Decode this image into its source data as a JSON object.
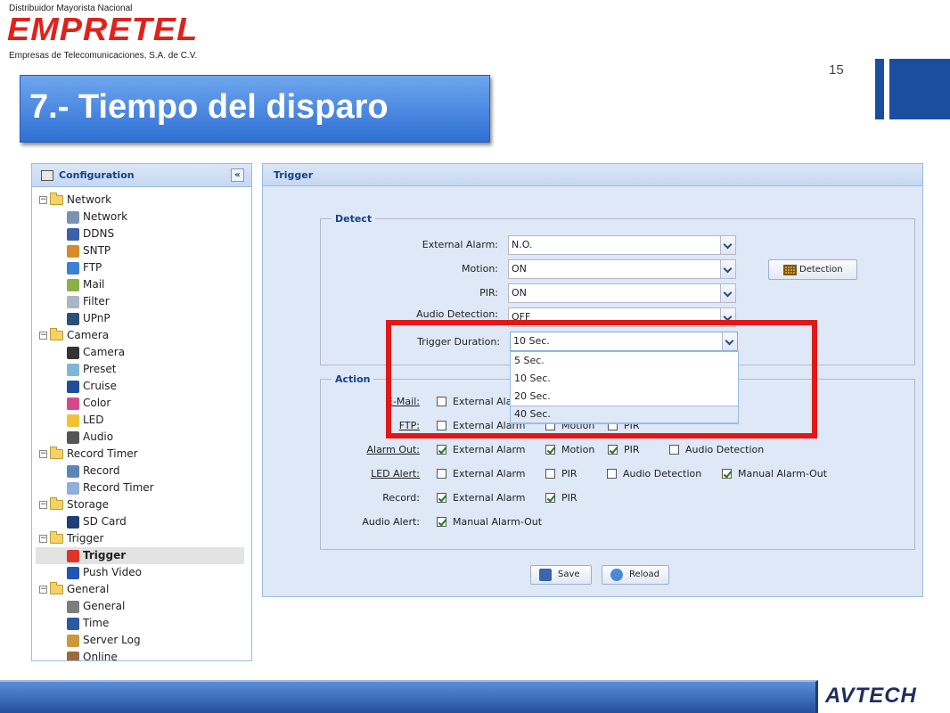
{
  "slide": {
    "logo": {
      "line1": "Distribuidor Mayorista Nacional",
      "brand": "EMPRETEL",
      "line3": "Empresas de Telecomunicaciones, S.A. de C.V."
    },
    "page_number": "15",
    "title": "7.- Tiempo del disparo",
    "footer_brand": "AVTECH",
    "accent_color": "#1a4fa0",
    "highlight_color": "#e01818"
  },
  "sidebar": {
    "title": "Configuration",
    "collapse_icon": "«",
    "tree": [
      {
        "type": "group",
        "label": "Network",
        "children": [
          {
            "label": "Network",
            "icon": "network-icon",
            "color": "#7b93b3"
          },
          {
            "label": "DDNS",
            "icon": "ddns-icon",
            "color": "#3a62a8"
          },
          {
            "label": "SNTP",
            "icon": "sntp-icon",
            "color": "#d88a2a"
          },
          {
            "label": "FTP",
            "icon": "ftp-icon",
            "color": "#3d7fd0"
          },
          {
            "label": "Mail",
            "icon": "mail-icon",
            "color": "#8ab04a"
          },
          {
            "label": "Filter",
            "icon": "filter-icon",
            "color": "#a9b6c8"
          },
          {
            "label": "UPnP",
            "icon": "upnp-icon",
            "color": "#2b4f7a"
          }
        ]
      },
      {
        "type": "group",
        "label": "Camera",
        "children": [
          {
            "label": "Camera",
            "icon": "camera-icon",
            "color": "#333333"
          },
          {
            "label": "Preset",
            "icon": "preset-icon",
            "color": "#7fb5d8"
          },
          {
            "label": "Cruise",
            "icon": "cruise-icon",
            "color": "#1f4f9a"
          },
          {
            "label": "Color",
            "icon": "color-icon",
            "color": "#d34a8c"
          },
          {
            "label": "LED",
            "icon": "led-icon",
            "color": "#f2c230"
          },
          {
            "label": "Audio",
            "icon": "audio-icon",
            "color": "#555555"
          }
        ]
      },
      {
        "type": "group",
        "label": "Record Timer",
        "children": [
          {
            "label": "Record",
            "icon": "record-icon",
            "color": "#5d86b8"
          },
          {
            "label": "Record Timer",
            "icon": "record-timer-icon",
            "color": "#8fb0d8"
          }
        ]
      },
      {
        "type": "group",
        "label": "Storage",
        "children": [
          {
            "label": "SD Card",
            "icon": "sd-card-icon",
            "color": "#1e3f7a"
          }
        ]
      },
      {
        "type": "group",
        "label": "Trigger",
        "children": [
          {
            "label": "Trigger",
            "icon": "trigger-icon",
            "color": "#e0332b",
            "selected": true
          },
          {
            "label": "Push Video",
            "icon": "push-video-icon",
            "color": "#1f55b5"
          }
        ]
      },
      {
        "type": "group",
        "label": "General",
        "children": [
          {
            "label": "General",
            "icon": "general-icon",
            "color": "#7d7d7d"
          },
          {
            "label": "Time",
            "icon": "time-icon",
            "color": "#2c5aa0"
          },
          {
            "label": "Server Log",
            "icon": "server-log-icon",
            "color": "#c89a3a"
          },
          {
            "label": "Online",
            "icon": "online-icon",
            "color": "#9a6a3a"
          }
        ]
      }
    ]
  },
  "panel": {
    "title": "Trigger",
    "detect": {
      "legend": "Detect",
      "external_alarm": {
        "label": "External Alarm:",
        "value": "N.O."
      },
      "motion": {
        "label": "Motion:",
        "value": "ON"
      },
      "pir": {
        "label": "PIR:",
        "value": "ON"
      },
      "audio_detection": {
        "label": "Audio Detection:",
        "value": "OFF"
      },
      "trigger_duration": {
        "label": "Trigger Duration:",
        "value": "10 Sec."
      },
      "detection_button": "Detection",
      "duration_options": [
        "5 Sec.",
        "10 Sec.",
        "20 Sec.",
        "40 Sec."
      ]
    },
    "action": {
      "legend": "Action",
      "rows": [
        {
          "label": "E-Mail:",
          "underline": true,
          "items": [
            {
              "label": "External Alarm",
              "checked": false
            }
          ]
        },
        {
          "label": "FTP:",
          "underline": true,
          "items": [
            {
              "label": "External Alarm",
              "checked": false
            },
            {
              "label": "Motion",
              "checked": false
            },
            {
              "label": "PIR",
              "checked": false
            }
          ]
        },
        {
          "label": "Alarm Out:",
          "underline": true,
          "items": [
            {
              "label": "External Alarm",
              "checked": true
            },
            {
              "label": "Motion",
              "checked": true
            },
            {
              "label": "PIR",
              "checked": true
            },
            {
              "label": "Audio Detection",
              "checked": false
            }
          ]
        },
        {
          "label": "LED Alert:",
          "underline": true,
          "items": [
            {
              "label": "External Alarm",
              "checked": false
            },
            {
              "label": "PIR",
              "checked": false
            },
            {
              "label": "Audio Detection",
              "checked": false
            },
            {
              "label": "Manual Alarm-Out",
              "checked": true
            }
          ]
        },
        {
          "label": "Record:",
          "underline": false,
          "items": [
            {
              "label": "External Alarm",
              "checked": true
            },
            {
              "label": "PIR",
              "checked": true
            }
          ]
        },
        {
          "label": "Audio Alert:",
          "underline": false,
          "items": [
            {
              "label": "Manual Alarm-Out",
              "checked": true
            }
          ]
        }
      ]
    },
    "buttons": {
      "save": "Save",
      "reload": "Reload"
    }
  }
}
